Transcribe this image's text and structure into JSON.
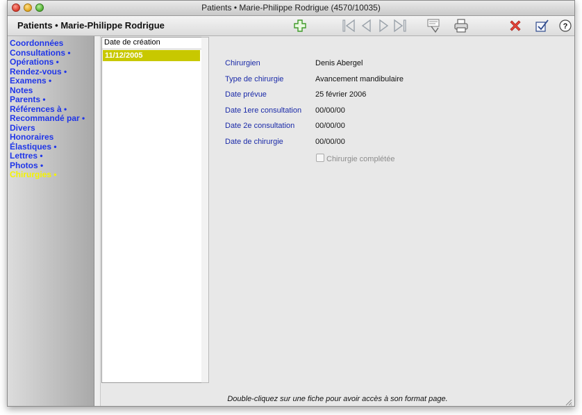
{
  "window": {
    "title": "Patients • Marie-Philippe Rodrigue (4570/10035)"
  },
  "toolbar": {
    "header_title": "Patients • Marie-Philippe Rodrigue",
    "icons": [
      "add-icon",
      "first-record-icon",
      "previous-record-icon",
      "next-record-icon",
      "last-record-icon",
      "stamp-icon",
      "print-icon",
      "delete-icon",
      "validate-icon",
      "help-icon"
    ]
  },
  "sidebar": {
    "items": [
      {
        "label": "Coordonnées"
      },
      {
        "label": "Consultations •"
      },
      {
        "label": "Opérations •"
      },
      {
        "label": "Rendez-vous •"
      },
      {
        "label": "Examens •"
      },
      {
        "label": "Notes"
      },
      {
        "label": "Parents •"
      },
      {
        "label": "Références à •"
      },
      {
        "label": "Recommandé par •"
      },
      {
        "label": "Divers"
      },
      {
        "label": "Honoraires"
      },
      {
        "label": "Élastiques •"
      },
      {
        "label": "Lettres •"
      },
      {
        "label": "Photos •"
      },
      {
        "label": "Chirurgies •"
      }
    ],
    "active_index": 14
  },
  "list": {
    "header": "Date de création",
    "rows": [
      "11/12/2005"
    ]
  },
  "detail": {
    "fields": [
      {
        "label": "Chirurgien",
        "value": "Denis Abergel"
      },
      {
        "label": "Type de chirurgie",
        "value": "Avancement mandibulaire"
      },
      {
        "label": "Date prévue",
        "value": "25 février 2006"
      },
      {
        "label": "Date 1ere consultation",
        "value": "00/00/00"
      },
      {
        "label": "Date 2e consultation",
        "value": "00/00/00"
      },
      {
        "label": "Date de chirurgie",
        "value": "00/00/00"
      }
    ],
    "checkbox_label": "Chirurgie complétée",
    "checkbox_checked": false
  },
  "footer": {
    "hint": "Double-cliquez sur une fiche pour avoir accès à son format page."
  },
  "colors": {
    "label_blue": "#1a2aa8",
    "sidebar_link": "#2036e8",
    "sidebar_active": "#f4f400",
    "selection": "#c8c800"
  }
}
